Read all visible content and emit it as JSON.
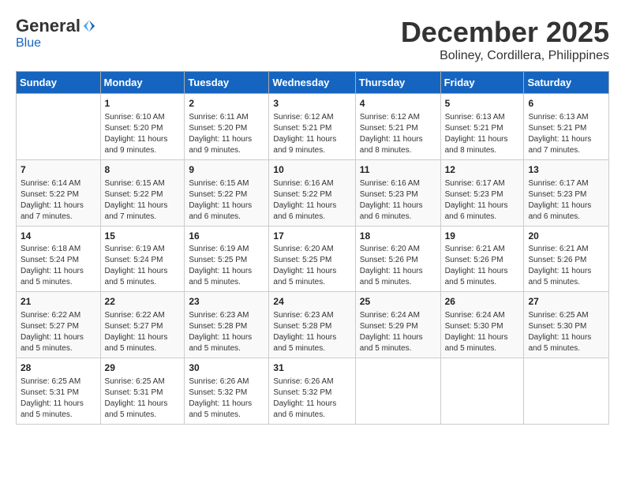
{
  "logo": {
    "general": "General",
    "blue": "Blue"
  },
  "title": {
    "month": "December 2025",
    "location": "Boliney, Cordillera, Philippines"
  },
  "header_days": [
    "Sunday",
    "Monday",
    "Tuesday",
    "Wednesday",
    "Thursday",
    "Friday",
    "Saturday"
  ],
  "weeks": [
    [
      {
        "day": "",
        "info": ""
      },
      {
        "day": "1",
        "info": "Sunrise: 6:10 AM\nSunset: 5:20 PM\nDaylight: 11 hours\nand 9 minutes."
      },
      {
        "day": "2",
        "info": "Sunrise: 6:11 AM\nSunset: 5:20 PM\nDaylight: 11 hours\nand 9 minutes."
      },
      {
        "day": "3",
        "info": "Sunrise: 6:12 AM\nSunset: 5:21 PM\nDaylight: 11 hours\nand 9 minutes."
      },
      {
        "day": "4",
        "info": "Sunrise: 6:12 AM\nSunset: 5:21 PM\nDaylight: 11 hours\nand 8 minutes."
      },
      {
        "day": "5",
        "info": "Sunrise: 6:13 AM\nSunset: 5:21 PM\nDaylight: 11 hours\nand 8 minutes."
      },
      {
        "day": "6",
        "info": "Sunrise: 6:13 AM\nSunset: 5:21 PM\nDaylight: 11 hours\nand 7 minutes."
      }
    ],
    [
      {
        "day": "7",
        "info": "Sunrise: 6:14 AM\nSunset: 5:22 PM\nDaylight: 11 hours\nand 7 minutes."
      },
      {
        "day": "8",
        "info": "Sunrise: 6:15 AM\nSunset: 5:22 PM\nDaylight: 11 hours\nand 7 minutes."
      },
      {
        "day": "9",
        "info": "Sunrise: 6:15 AM\nSunset: 5:22 PM\nDaylight: 11 hours\nand 6 minutes."
      },
      {
        "day": "10",
        "info": "Sunrise: 6:16 AM\nSunset: 5:22 PM\nDaylight: 11 hours\nand 6 minutes."
      },
      {
        "day": "11",
        "info": "Sunrise: 6:16 AM\nSunset: 5:23 PM\nDaylight: 11 hours\nand 6 minutes."
      },
      {
        "day": "12",
        "info": "Sunrise: 6:17 AM\nSunset: 5:23 PM\nDaylight: 11 hours\nand 6 minutes."
      },
      {
        "day": "13",
        "info": "Sunrise: 6:17 AM\nSunset: 5:23 PM\nDaylight: 11 hours\nand 6 minutes."
      }
    ],
    [
      {
        "day": "14",
        "info": "Sunrise: 6:18 AM\nSunset: 5:24 PM\nDaylight: 11 hours\nand 5 minutes."
      },
      {
        "day": "15",
        "info": "Sunrise: 6:19 AM\nSunset: 5:24 PM\nDaylight: 11 hours\nand 5 minutes."
      },
      {
        "day": "16",
        "info": "Sunrise: 6:19 AM\nSunset: 5:25 PM\nDaylight: 11 hours\nand 5 minutes."
      },
      {
        "day": "17",
        "info": "Sunrise: 6:20 AM\nSunset: 5:25 PM\nDaylight: 11 hours\nand 5 minutes."
      },
      {
        "day": "18",
        "info": "Sunrise: 6:20 AM\nSunset: 5:26 PM\nDaylight: 11 hours\nand 5 minutes."
      },
      {
        "day": "19",
        "info": "Sunrise: 6:21 AM\nSunset: 5:26 PM\nDaylight: 11 hours\nand 5 minutes."
      },
      {
        "day": "20",
        "info": "Sunrise: 6:21 AM\nSunset: 5:26 PM\nDaylight: 11 hours\nand 5 minutes."
      }
    ],
    [
      {
        "day": "21",
        "info": "Sunrise: 6:22 AM\nSunset: 5:27 PM\nDaylight: 11 hours\nand 5 minutes."
      },
      {
        "day": "22",
        "info": "Sunrise: 6:22 AM\nSunset: 5:27 PM\nDaylight: 11 hours\nand 5 minutes."
      },
      {
        "day": "23",
        "info": "Sunrise: 6:23 AM\nSunset: 5:28 PM\nDaylight: 11 hours\nand 5 minutes."
      },
      {
        "day": "24",
        "info": "Sunrise: 6:23 AM\nSunset: 5:28 PM\nDaylight: 11 hours\nand 5 minutes."
      },
      {
        "day": "25",
        "info": "Sunrise: 6:24 AM\nSunset: 5:29 PM\nDaylight: 11 hours\nand 5 minutes."
      },
      {
        "day": "26",
        "info": "Sunrise: 6:24 AM\nSunset: 5:30 PM\nDaylight: 11 hours\nand 5 minutes."
      },
      {
        "day": "27",
        "info": "Sunrise: 6:25 AM\nSunset: 5:30 PM\nDaylight: 11 hours\nand 5 minutes."
      }
    ],
    [
      {
        "day": "28",
        "info": "Sunrise: 6:25 AM\nSunset: 5:31 PM\nDaylight: 11 hours\nand 5 minutes."
      },
      {
        "day": "29",
        "info": "Sunrise: 6:25 AM\nSunset: 5:31 PM\nDaylight: 11 hours\nand 5 minutes."
      },
      {
        "day": "30",
        "info": "Sunrise: 6:26 AM\nSunset: 5:32 PM\nDaylight: 11 hours\nand 5 minutes."
      },
      {
        "day": "31",
        "info": "Sunrise: 6:26 AM\nSunset: 5:32 PM\nDaylight: 11 hours\nand 6 minutes."
      },
      {
        "day": "",
        "info": ""
      },
      {
        "day": "",
        "info": ""
      },
      {
        "day": "",
        "info": ""
      }
    ]
  ]
}
